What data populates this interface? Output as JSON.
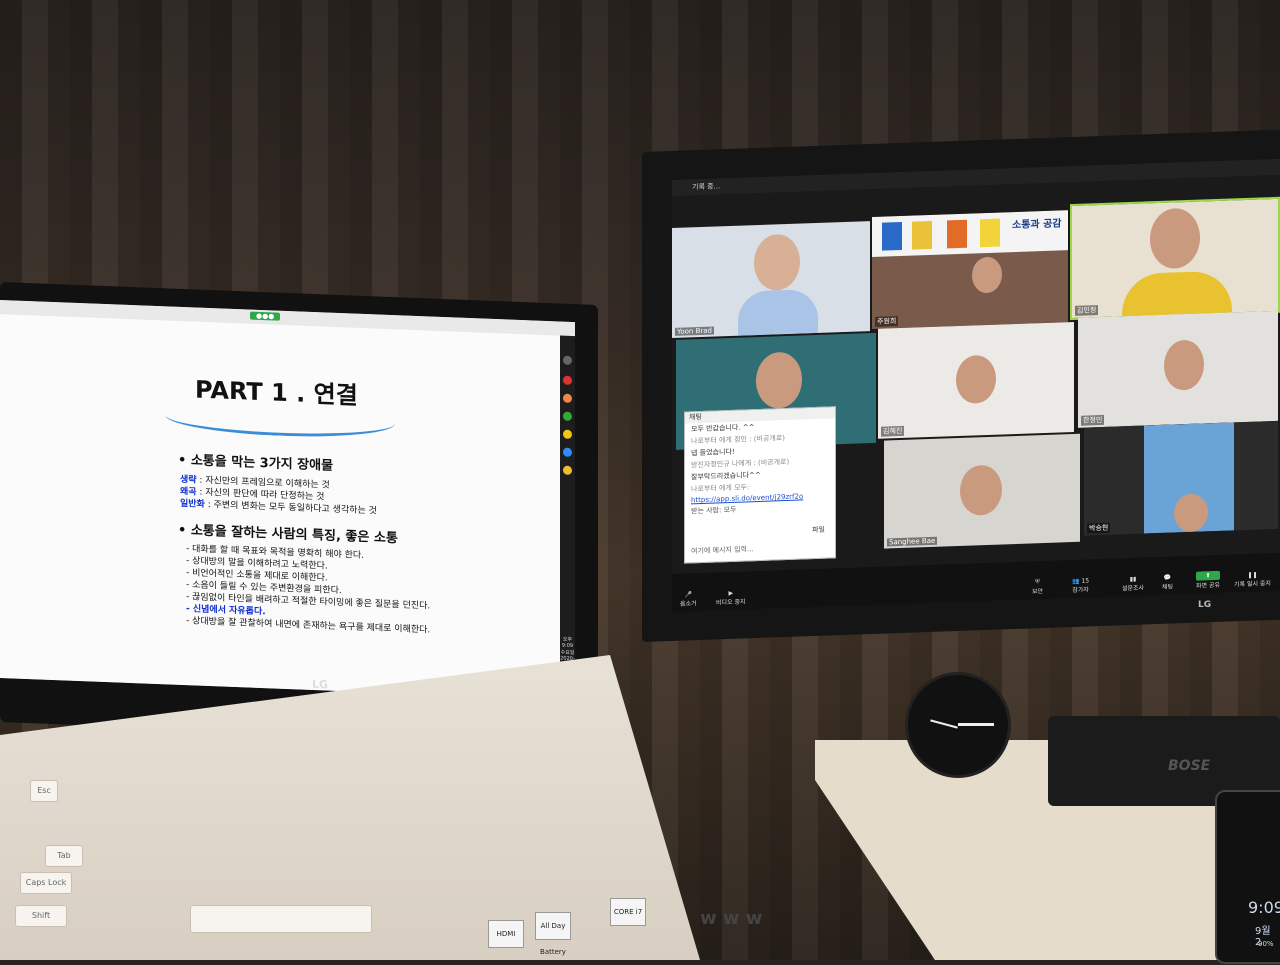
{
  "slide": {
    "title": "PART 1 . 연결",
    "section1_heading": "•  소통을 막는 3가지 장애물",
    "obstacles": [
      {
        "key": "생략",
        "text": " : 자신만의 프레임으로 이해하는 것"
      },
      {
        "key": "왜곡",
        "text": " : 자신의 판단에 따라 단정하는 것"
      },
      {
        "key": "일반화",
        "text": " : 주변의 변화는 모두 동일하다고 생각하는 것"
      }
    ],
    "section2_heading": "•  소통을 잘하는 사람의 특징, 좋은 소통",
    "traits": [
      "-   대화를 할 때 목표와 목적을 명확히 해야 한다.",
      "-   상대방의 말을 이해하려고 노력한다.",
      "-   비언어적인 소통을 제대로 이해한다.",
      "-   소음이 들릴 수 있는 주변환경을 피한다.",
      "-   끊임없이 타인을 배려하고 적절한 타이밍에 좋은 질문을 던진다.",
      "-   신념에서 자유롭다.",
      "-   상대방을 잘 관찰하여 내면에 존재하는 욕구를 제대로 이해한다."
    ],
    "highlight_trait_index": 5
  },
  "laptop": {
    "brand": "LG",
    "clock_time": "오후 9:09",
    "clock_day": "수요일",
    "clock_date": "2020-09-23",
    "sticker_hdmi": "HDMI",
    "sticker_battery": "All Day Battery",
    "sticker_intel": "CORE i7"
  },
  "monitor": {
    "brand": "LG",
    "top_text": "기록 중...",
    "book_title": "소통과 공감",
    "tiles": [
      {
        "name": "Yoon Brad"
      },
      {
        "name": "주원희"
      },
      {
        "name": "김민정"
      },
      {
        "name": ""
      },
      {
        "name": "김혜진"
      },
      {
        "name": "한정민"
      },
      {
        "name": "Sanghee Bae"
      },
      {
        "name": "박승현"
      }
    ],
    "chat": {
      "header": "채팅",
      "messages": [
        "모두 반갑습니다. ^^",
        "나로부터 에게 정민 : (비공개로)",
        "넵 들었습니다!",
        "방진자정민규 나에게 : (비공개로)",
        "잘부탁드리겠습니다^^",
        "나로부터 에게 모두:",
        "https://app.sli.do/event/j29zrf2o"
      ],
      "to_label": "받는 사람: 모두",
      "file_label": "파일",
      "placeholder": "여기에 메시지 입력..."
    },
    "toolbar": {
      "mute": "음소거",
      "video": "비디오 중지",
      "security": "보안",
      "participants": "참가자",
      "participants_count": "15",
      "poll": "설문조사",
      "chat": "채팅",
      "share": "화면 공유",
      "record": "기록 일시 중지"
    }
  },
  "desk": {
    "speaker_brand": "BOSE",
    "phone_time": "9:09",
    "phone_date": "9월 2",
    "phone_battery": "90%",
    "box_text": "w w w"
  }
}
